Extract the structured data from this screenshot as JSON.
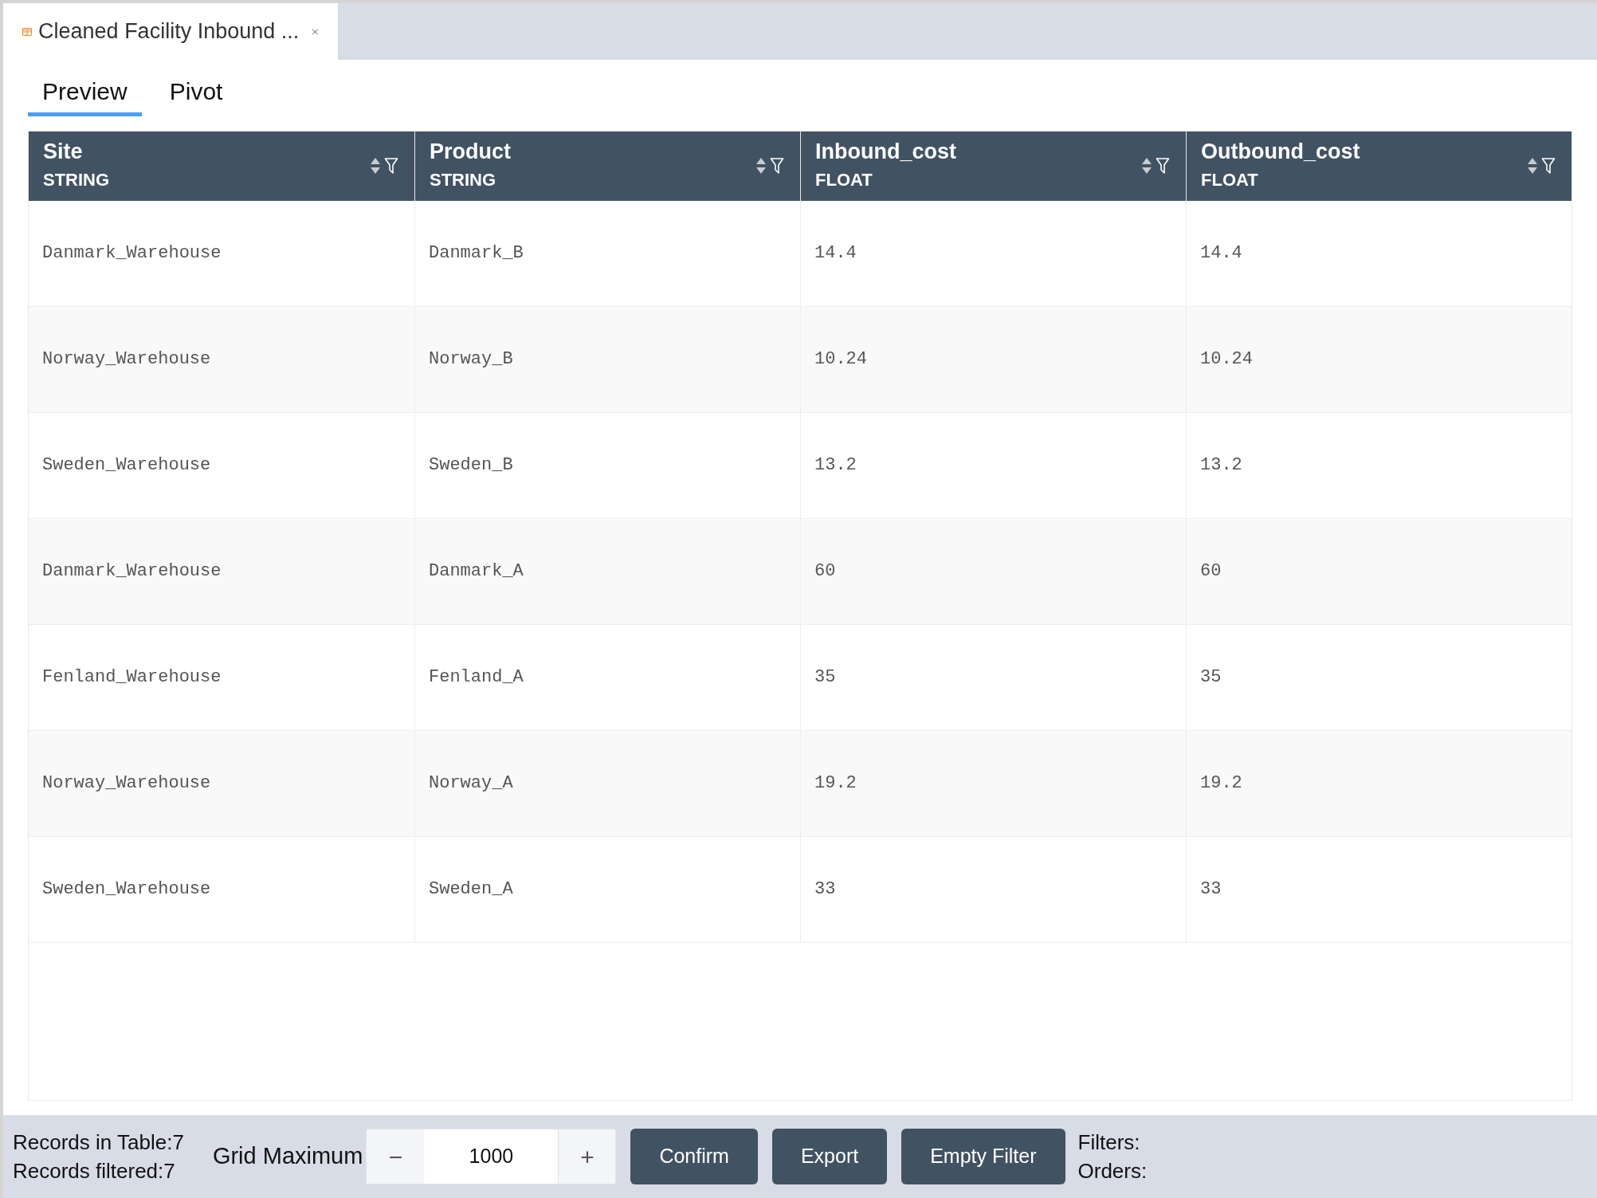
{
  "file_tab": {
    "title": "Cleaned Facility Inbound ...",
    "selected": true
  },
  "view_tabs": [
    {
      "label": "Preview",
      "selected": true
    },
    {
      "label": "Pivot",
      "selected": false
    }
  ],
  "table": {
    "columns": [
      {
        "name": "Site",
        "type": "STRING"
      },
      {
        "name": "Product",
        "type": "STRING"
      },
      {
        "name": "Inbound_cost",
        "type": "FLOAT"
      },
      {
        "name": "Outbound_cost",
        "type": "FLOAT"
      }
    ],
    "rows": [
      [
        "Danmark_Warehouse",
        "Danmark_B",
        "14.4",
        "14.4"
      ],
      [
        "Norway_Warehouse",
        "Norway_B",
        "10.24",
        "10.24"
      ],
      [
        "Sweden_Warehouse",
        "Sweden_B",
        "13.2",
        "13.2"
      ],
      [
        "Danmark_Warehouse",
        "Danmark_A",
        "60",
        "60"
      ],
      [
        "Fenland_Warehouse",
        "Fenland_A",
        "35",
        "35"
      ],
      [
        "Norway_Warehouse",
        "Norway_A",
        "19.2",
        "19.2"
      ],
      [
        "Sweden_Warehouse",
        "Sweden_A",
        "33",
        "33"
      ]
    ]
  },
  "status_bar": {
    "records_in_table": "Records in Table:7",
    "records_filtered": "Records filtered:7",
    "grid_maximum_label": "Grid Maximum",
    "decrement": "−",
    "grid_maximum_value": "1000",
    "increment": "+",
    "buttons": [
      "Confirm",
      "Export",
      "Empty Filter"
    ],
    "filters": "Filters:",
    "orders": "Orders:"
  }
}
